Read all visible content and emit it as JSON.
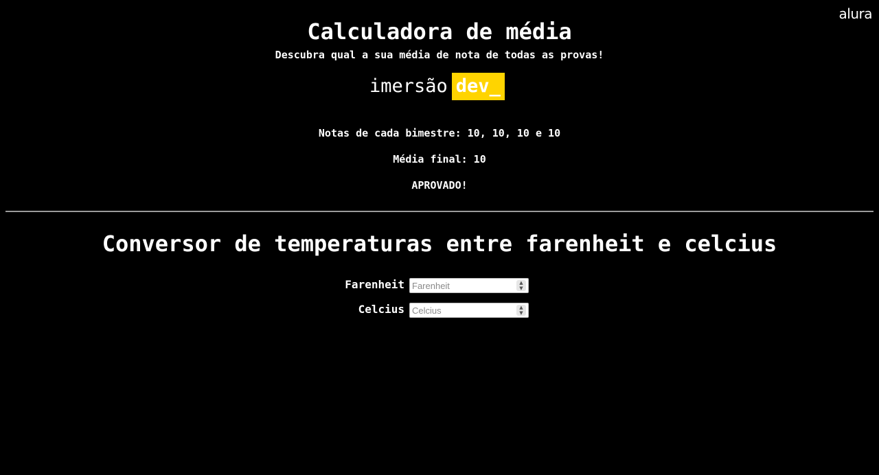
{
  "brand": {
    "logo_text": "alura"
  },
  "header": {
    "title": "Calculadora de média",
    "subtitle": "Descubra qual a sua média de nota de todas as provas!"
  },
  "imersao_logo": {
    "word": "imersão",
    "badge": "dev_",
    "badge_color": "#ffd400"
  },
  "results": {
    "notas_label": "Notas de cada bimestre:",
    "notas_value": "10, 10, 10 e 10",
    "media_label": "Média final:",
    "media_value": "10",
    "status": "APROVADO!"
  },
  "converter": {
    "title": "Conversor de temperaturas entre farenheit e celcius",
    "fields": [
      {
        "label": "Farenheit",
        "placeholder": "Farenheit",
        "value": ""
      },
      {
        "label": "Celcius",
        "placeholder": "Celcius",
        "value": ""
      }
    ]
  },
  "icons": {
    "spinner_up": "chevron-up-icon",
    "spinner_down": "chevron-down-icon"
  }
}
